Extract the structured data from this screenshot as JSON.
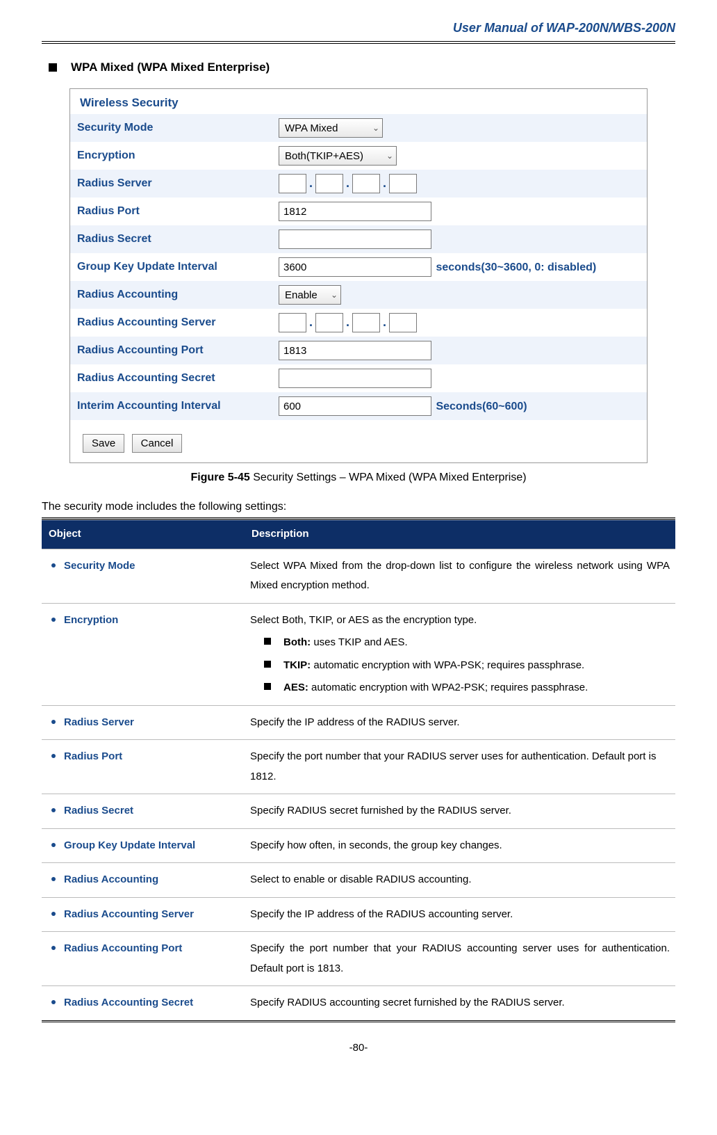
{
  "header": {
    "title": "User Manual of WAP-200N/WBS-200N"
  },
  "section": {
    "title": "WPA Mixed (WPA Mixed Enterprise)"
  },
  "form": {
    "heading": "Wireless Security",
    "rows": {
      "security_mode": {
        "label": "Security Mode",
        "value": "WPA Mixed"
      },
      "encryption": {
        "label": "Encryption",
        "value": "Both(TKIP+AES)"
      },
      "radius_server": {
        "label": "Radius Server"
      },
      "radius_port": {
        "label": "Radius Port",
        "value": "1812"
      },
      "radius_secret": {
        "label": "Radius Secret",
        "value": ""
      },
      "group_key": {
        "label": "Group Key Update Interval",
        "value": "3600",
        "suffix": "seconds(30~3600, 0: disabled)"
      },
      "radius_acct": {
        "label": "Radius Accounting",
        "value": "Enable"
      },
      "acct_server": {
        "label": "Radius Accounting Server"
      },
      "acct_port": {
        "label": "Radius Accounting Port",
        "value": "1813"
      },
      "acct_secret": {
        "label": "Radius Accounting Secret",
        "value": ""
      },
      "interim": {
        "label": "Interim Accounting Interval",
        "value": "600",
        "suffix": "Seconds(60~600)"
      }
    },
    "buttons": {
      "save": "Save",
      "cancel": "Cancel"
    }
  },
  "caption": {
    "bold": "Figure 5-45",
    "rest": " Security Settings – WPA Mixed (WPA Mixed Enterprise)"
  },
  "intro": "The security mode includes the following settings:",
  "tableHeader": {
    "object": "Object",
    "description": "Description"
  },
  "settings": [
    {
      "obj": "Security Mode",
      "desc": "Select WPA Mixed from the drop-down list to configure the wireless network using WPA Mixed encryption method."
    },
    {
      "obj": "Encryption",
      "desc_intro": "Select Both, TKIP, or AES as the encryption type.",
      "subs": [
        {
          "bold": "Both:",
          "text": " uses TKIP and AES."
        },
        {
          "bold": "TKIP:",
          "text": " automatic encryption with WPA-PSK; requires passphrase."
        },
        {
          "bold": "AES:",
          "text": " automatic encryption with WPA2-PSK; requires passphrase."
        }
      ]
    },
    {
      "obj": "Radius Server",
      "desc": "Specify the IP address of the RADIUS server."
    },
    {
      "obj": "Radius Port",
      "desc": "Specify the port number that your RADIUS server uses for authentication. Default port is 1812."
    },
    {
      "obj": "Radius Secret",
      "desc": "Specify RADIUS secret furnished by the RADIUS server."
    },
    {
      "obj": "Group Key Update Interval",
      "desc": "Specify how often, in seconds, the group key changes."
    },
    {
      "obj": "Radius Accounting",
      "desc": "Select to enable or disable RADIUS accounting."
    },
    {
      "obj": "Radius Accounting Server",
      "desc": "Specify the IP address of the RADIUS accounting server."
    },
    {
      "obj": "Radius Accounting Port",
      "desc": "Specify the port number that your RADIUS accounting server uses for authentication. Default port is 1813."
    },
    {
      "obj": "Radius Accounting Secret",
      "desc": "Specify RADIUS accounting secret furnished by the RADIUS server."
    }
  ],
  "footer": "-80-"
}
